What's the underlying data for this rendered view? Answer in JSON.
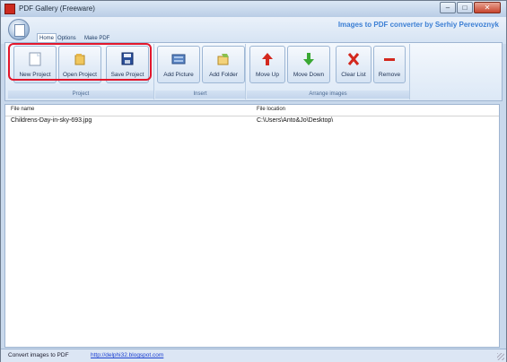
{
  "window": {
    "title": "PDF Gallery (Freeware)"
  },
  "controls": {
    "minimize": "–",
    "maximize": "□",
    "close": "✕"
  },
  "tabs": [
    {
      "label": "Home",
      "active": true
    },
    {
      "label": "Options",
      "active": false
    },
    {
      "label": "Make PDF",
      "active": false
    }
  ],
  "brand": "Images to PDF converter by Serhiy Perevoznyk",
  "ribbon": {
    "groups": [
      {
        "label": "Project",
        "buttons": [
          {
            "label": "New Project",
            "icon": "new-document-icon"
          },
          {
            "label": "Open Project",
            "icon": "open-folder-icon"
          },
          {
            "label": "Save Project",
            "icon": "floppy-disk-icon"
          }
        ]
      },
      {
        "label": "Insert",
        "buttons": [
          {
            "label": "Add Picture",
            "icon": "picture-icon"
          },
          {
            "label": "Add Folder",
            "icon": "folder-icon"
          }
        ]
      },
      {
        "label": "Arrange images",
        "buttons": [
          {
            "label": "Move Up",
            "icon": "arrow-up-icon"
          },
          {
            "label": "Move Down",
            "icon": "arrow-down-icon"
          },
          {
            "label": "Clear List",
            "icon": "red-x-icon"
          },
          {
            "label": "Remove",
            "icon": "red-minus-icon"
          }
        ]
      }
    ]
  },
  "table": {
    "columns": [
      "File name",
      "File location"
    ],
    "rows": [
      [
        "Childrens-Day-in-sky-693.jpg",
        "C:\\Users\\Anto&Jo\\Desktop\\"
      ]
    ]
  },
  "status": {
    "text": "Convert images to PDF",
    "link": "http://delphi32.blogspot.com"
  },
  "colors": {
    "accent": "#3c7fd4",
    "highlight": "#e2172c"
  }
}
